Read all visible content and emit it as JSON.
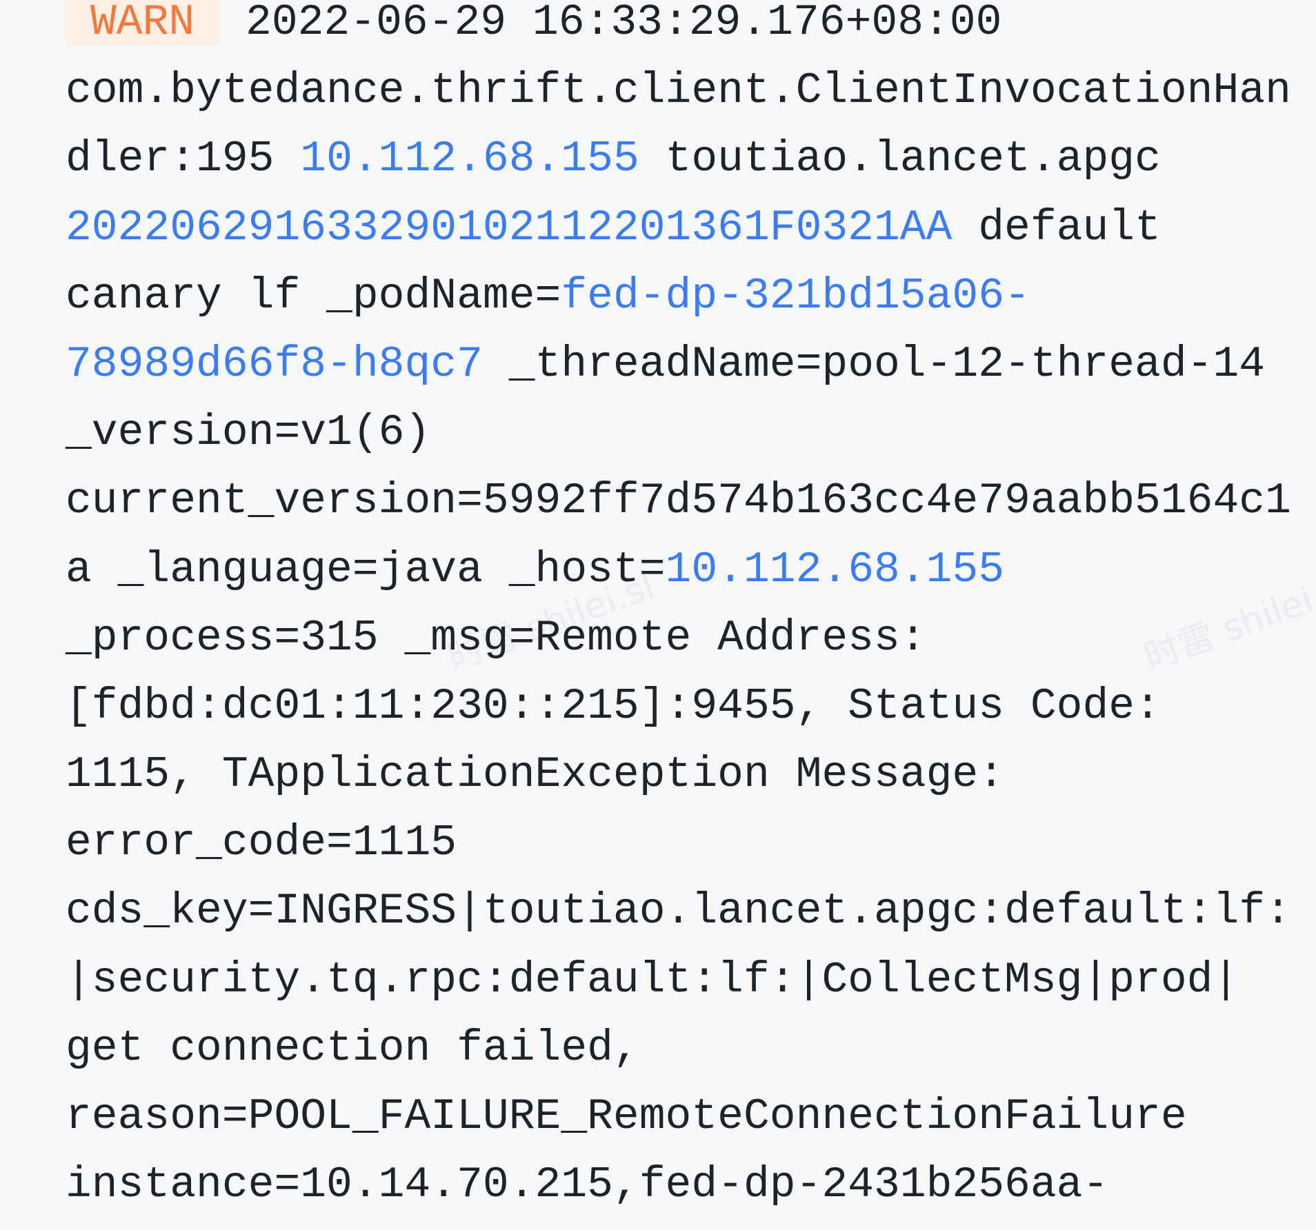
{
  "log_entry": {
    "level": "WARN",
    "colors": {
      "text": "#1f2329",
      "highlight": "#3b7cf0",
      "warn_text": "#f07a3e",
      "warn_bg": "#fdefe4",
      "background": "#f5f7f9"
    },
    "lines": [
      [
        {
          "t": "WARN",
          "k": "badge"
        },
        {
          "t": " 2022-06-29 16:33:29.176+08:00",
          "k": "text"
        }
      ],
      [
        {
          "t": "com.bytedance.thrift.client.ClientInvocationHan",
          "k": "text"
        }
      ],
      [
        {
          "t": "dler:195 ",
          "k": "text"
        },
        {
          "t": "10.112.68.155",
          "k": "hl"
        },
        {
          "t": " toutiao.lancet.apgc",
          "k": "text"
        }
      ],
      [
        {
          "t": "202206291633290102112201361F0321AA",
          "k": "hl"
        },
        {
          "t": " default",
          "k": "text"
        }
      ],
      [
        {
          "t": "canary lf _podName=",
          "k": "text"
        },
        {
          "t": "fed-dp-321bd15a06-",
          "k": "hl"
        }
      ],
      [
        {
          "t": "78989d66f8-h8qc7",
          "k": "hl"
        },
        {
          "t": " _threadName=pool-12-thread-14",
          "k": "text"
        }
      ],
      [
        {
          "t": "_version=v1(6)",
          "k": "text"
        }
      ],
      [
        {
          "t": "current_version=5992ff7d574b163cc4e79aabb5164c1",
          "k": "text"
        }
      ],
      [
        {
          "t": "a _language=java _host=",
          "k": "text"
        },
        {
          "t": "10.112.68.155",
          "k": "hl"
        }
      ],
      [
        {
          "t": "_process=315 _msg=Remote Address:",
          "k": "text"
        }
      ],
      [
        {
          "t": "[fdbd:dc01:11:230::215]:9455, Status Code:",
          "k": "text"
        }
      ],
      [
        {
          "t": "1115, TApplicationException Message:",
          "k": "text"
        }
      ],
      [
        {
          "t": "error_code=1115",
          "k": "text"
        }
      ],
      [
        {
          "t": "cds_key=INGRESS|toutiao.lancet.apgc:default:lf:",
          "k": "text"
        }
      ],
      [
        {
          "t": "|security.tq.rpc:default:lf:|CollectMsg|prod|",
          "k": "text"
        }
      ],
      [
        {
          "t": "get connection failed,",
          "k": "text"
        }
      ],
      [
        {
          "t": "reason=POOL_FAILURE_RemoteConnectionFailure",
          "k": "text"
        }
      ],
      [
        {
          "t": "instance=10.14.70.215,fed-dp-2431b256aa-",
          "k": "text"
        }
      ]
    ]
  },
  "watermark": "时雷 shilei.sl"
}
